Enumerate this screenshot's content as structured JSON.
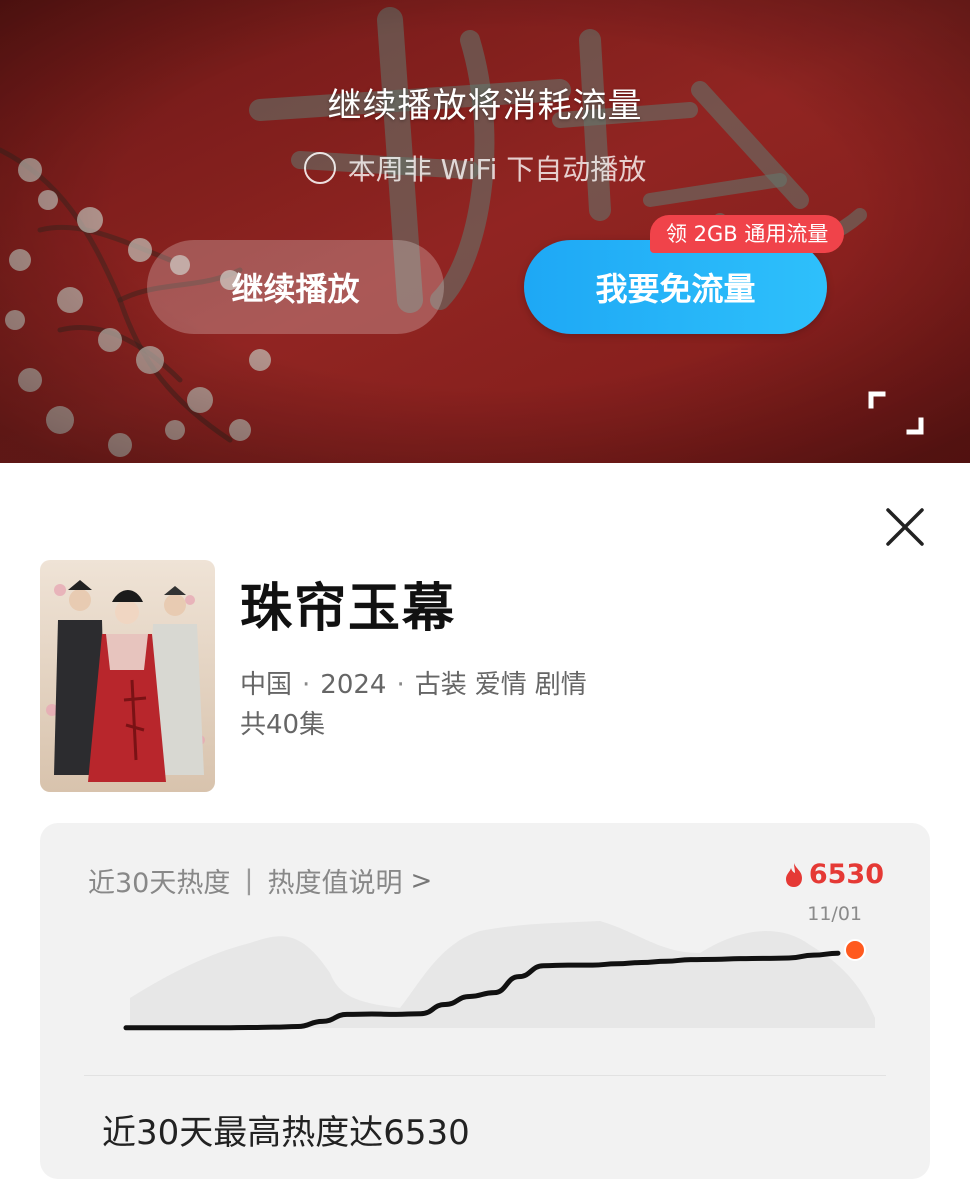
{
  "overlay": {
    "title": "继续播放将消耗流量",
    "auto_play_option": "本周非 WiFi 下自动播放",
    "continue_label": "继续播放",
    "free_label": "我要免流量",
    "badge_label": "领 2GB 通用流量"
  },
  "show": {
    "title": "珠帘玉幕",
    "country": "中国",
    "year": "2024",
    "genres": [
      "古装",
      "爱情",
      "剧情"
    ],
    "episodes": "共40集"
  },
  "heat": {
    "label": "近30天热度",
    "separator": "|",
    "explain_label": "热度值说明",
    "chevron": ">",
    "value": "6530",
    "date": "11/01",
    "summary": "近30天最高热度达6530"
  },
  "chart_data": {
    "type": "line",
    "title": "近30天热度",
    "xlabel": "",
    "ylabel": "",
    "series": [
      {
        "values": [
          1100,
          1100,
          1100,
          1100,
          1100,
          1110,
          1120,
          1140,
          1300,
          1520,
          1530,
          1520,
          1540,
          1830,
          2080,
          2200,
          2700,
          3040,
          3060,
          3060,
          3100,
          3140,
          3180,
          3230,
          3240,
          3260,
          3270,
          3280,
          3370,
          3430
        ]
      }
    ],
    "peak": {
      "value": 6530,
      "date": "11/01"
    },
    "grid": false,
    "legend": "none"
  },
  "icons": {
    "close": "close-icon",
    "fullscreen": "fullscreen-icon",
    "flame": "flame-icon",
    "radio": "radio-unchecked-icon"
  },
  "colors": {
    "free_button": "#1ea8f5",
    "badge": "#f0434a",
    "heat_value": "#e53935",
    "peak_dot": "#ff5a1f",
    "heat_line": "#111111"
  }
}
